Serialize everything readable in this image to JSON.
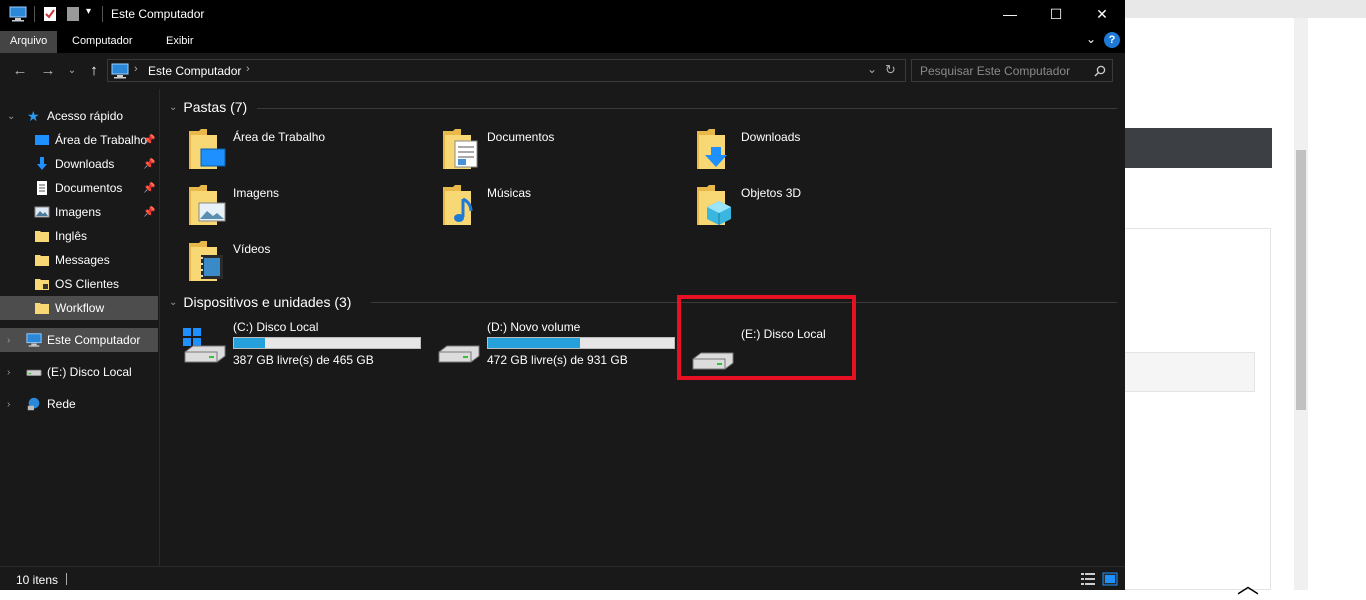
{
  "window": {
    "title": "Este Computador",
    "minimize_label": "—",
    "maximize_label": "☐",
    "close_label": "✕"
  },
  "ribbon": {
    "tabs": [
      {
        "label": "Arquivo",
        "active": true
      },
      {
        "label": "Computador",
        "active": false
      },
      {
        "label": "Exibir",
        "active": false
      }
    ]
  },
  "address": {
    "path": "Este Computador",
    "search_placeholder": "Pesquisar Este Computador"
  },
  "nav": {
    "items": [
      {
        "label": "Acesso rápido",
        "pinned": false
      },
      {
        "label": "Área de Trabalho",
        "pinned": true
      },
      {
        "label": "Downloads",
        "pinned": true
      },
      {
        "label": "Documentos",
        "pinned": true
      },
      {
        "label": "Imagens",
        "pinned": true
      },
      {
        "label": "Inglês",
        "pinned": false
      },
      {
        "label": "Messages",
        "pinned": false
      },
      {
        "label": "OS Clientes",
        "pinned": false
      },
      {
        "label": "Workflow",
        "pinned": false
      },
      {
        "label": "Este Computador",
        "pinned": false
      },
      {
        "label": "(E:) Disco Local",
        "pinned": false
      },
      {
        "label": "Rede",
        "pinned": false
      }
    ]
  },
  "folders": {
    "header": "Pastas (7)",
    "items": [
      {
        "label": "Área de Trabalho",
        "icon": "desktop-folder-icon"
      },
      {
        "label": "Documentos",
        "icon": "documents-folder-icon"
      },
      {
        "label": "Downloads",
        "icon": "downloads-folder-icon"
      },
      {
        "label": "Imagens",
        "icon": "pictures-folder-icon"
      },
      {
        "label": "Músicas",
        "icon": "music-folder-icon"
      },
      {
        "label": "Objetos 3D",
        "icon": "3d-objects-folder-icon"
      },
      {
        "label": "Vídeos",
        "icon": "videos-folder-icon"
      }
    ]
  },
  "devices": {
    "header": "Dispositivos e unidades (3)",
    "items": [
      {
        "name": "(C:) Disco Local",
        "free": "387 GB livre(s) de 465 GB",
        "used_fraction": 0.168
      },
      {
        "name": "(D:) Novo volume",
        "free": "472 GB livre(s) de 931 GB",
        "used_fraction": 0.493
      },
      {
        "name": "(E:) Disco Local",
        "free": "",
        "used_fraction": null
      }
    ]
  },
  "status": {
    "count": "10 itens"
  },
  "colors": {
    "accent": "#26a0da",
    "highlight": "#e81123"
  }
}
